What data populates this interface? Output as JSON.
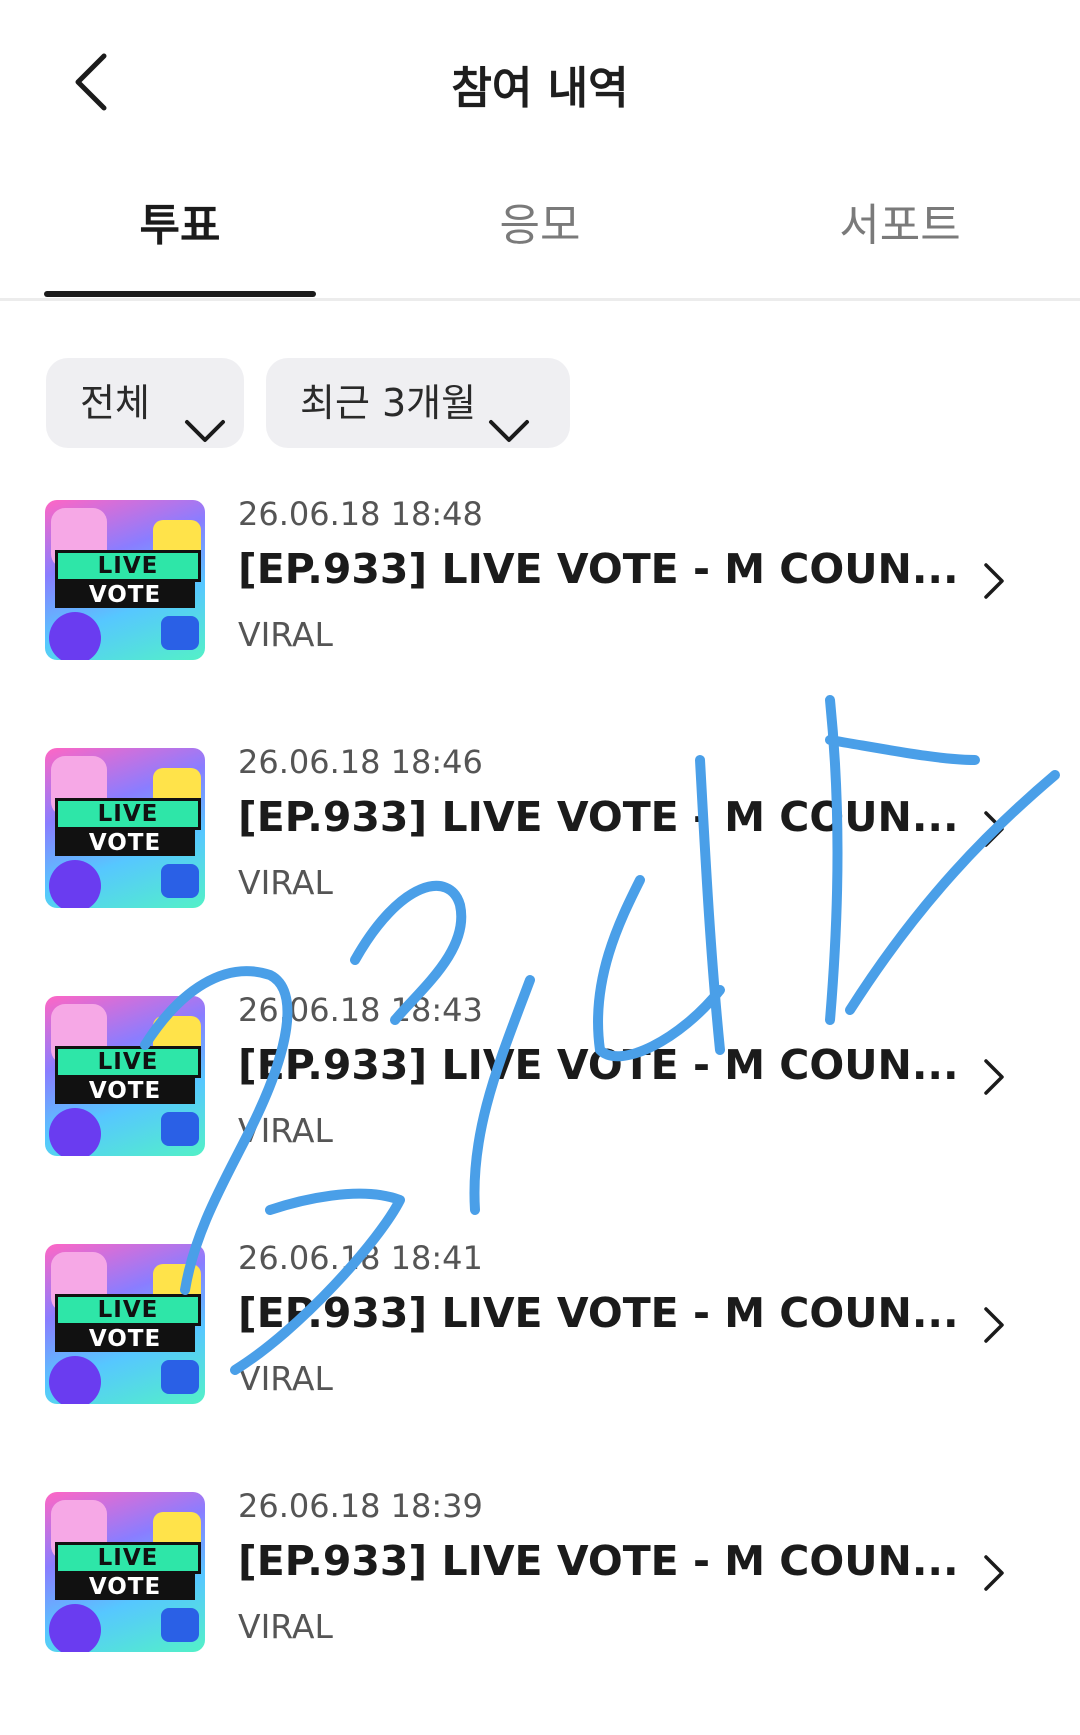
{
  "header": {
    "title": "참여 내역",
    "back_icon": "chevron-left-icon"
  },
  "tabs": [
    {
      "label": "투표",
      "active": true
    },
    {
      "label": "응모",
      "active": false
    },
    {
      "label": "서포트",
      "active": false
    }
  ],
  "filters": {
    "type": {
      "label": "전체",
      "icon": "chevron-down-icon"
    },
    "period": {
      "label": "최근 3개월",
      "icon": "chevron-down-icon"
    }
  },
  "items": [
    {
      "date": "26.06.18 18:48",
      "title": "[EP.933] LIVE VOTE - M COUN...",
      "category": "VIRAL",
      "thumb_text": [
        "LIVE",
        "VOTE"
      ]
    },
    {
      "date": "26.06.18 18:46",
      "title": "[EP.933] LIVE VOTE - M COUN...",
      "category": "VIRAL",
      "thumb_text": [
        "LIVE",
        "VOTE"
      ]
    },
    {
      "date": "26.06.18 18:43",
      "title": "[EP.933] LIVE VOTE - M COUN...",
      "category": "VIRAL",
      "thumb_text": [
        "LIVE",
        "VOTE"
      ]
    },
    {
      "date": "26.06.18 18:41",
      "title": "[EP.933] LIVE VOTE - M COUN...",
      "category": "VIRAL",
      "thumb_text": [
        "LIVE",
        "VOTE"
      ]
    },
    {
      "date": "26.06.18 18:39",
      "title": "[EP.933] LIVE VOTE - M COUN...",
      "category": "VIRAL",
      "thumb_text": [
        "LIVE",
        "VOTE"
      ]
    }
  ],
  "colors": {
    "accent_text": "#1b1b1b",
    "muted_text": "#7a7a7a",
    "chip_bg": "#efeff2",
    "scribble": "#4a9fe8"
  }
}
